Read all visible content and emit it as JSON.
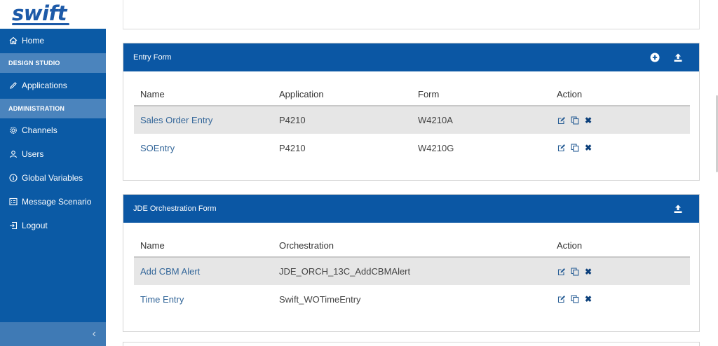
{
  "app": {
    "logo_text": "swift"
  },
  "sidebar": {
    "home": "Home",
    "section_design": "DESIGN STUDIO",
    "applications": "Applications",
    "section_admin": "ADMINISTRATION",
    "channels": "Channels",
    "users": "Users",
    "global_variables": "Global Variables",
    "message_scenario": "Message Scenario",
    "logout": "Logout",
    "collapse_icon": "‹"
  },
  "entry_form": {
    "title": "Entry Form",
    "columns": [
      "Name",
      "Application",
      "Form",
      "Action"
    ],
    "rows": [
      {
        "name": "Sales Order Entry",
        "application": "P4210",
        "form": "W4210A"
      },
      {
        "name": "SOEntry",
        "application": "P4210",
        "form": "W4210G"
      }
    ]
  },
  "orch_form": {
    "title": "JDE Orchestration Form",
    "columns": [
      "Name",
      "Orchestration",
      "Action"
    ],
    "rows": [
      {
        "name": "Add CBM Alert",
        "orchestration": "JDE_ORCH_13C_AddCBMAlert"
      },
      {
        "name": "Time Entry",
        "orchestration": "Swift_WOTimeEntry"
      }
    ]
  },
  "icons": {
    "delete_glyph": "✖"
  },
  "colors": {
    "brand": "#0b57a4",
    "section": "#4b84bd",
    "link": "#336699"
  }
}
